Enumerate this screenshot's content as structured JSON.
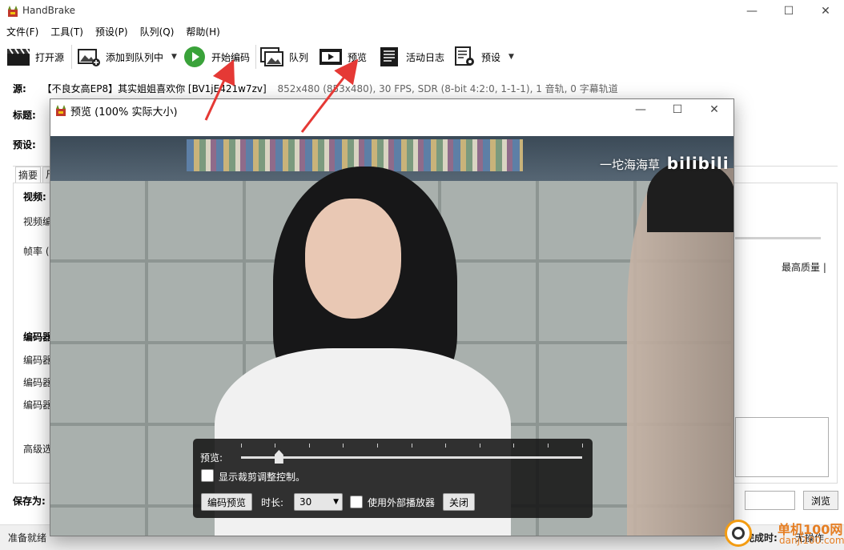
{
  "app": {
    "title": "HandBrake"
  },
  "window_controls": {
    "minimize": "—",
    "maximize": "☐",
    "close": "✕"
  },
  "menu": [
    "文件(F)",
    "工具(T)",
    "预设(P)",
    "队列(Q)",
    "帮助(H)"
  ],
  "toolbar": {
    "open_source": "打开源",
    "add_to_queue": "添加到队列中",
    "start_encode": "开始编码",
    "queue": "队列",
    "preview": "预览",
    "activity_log": "活动日志",
    "presets": "预设"
  },
  "source": {
    "label": "源:",
    "name": "【不良女高EP8】其实姐姐喜欢你 [BV1jE421w7zv]",
    "meta": "852x480 (853x480), 30 FPS, SDR (8-bit 4:2:0, 1-1-1), 1 音轨, 0 字幕轨道"
  },
  "main": {
    "title_label": "标题:",
    "preset_label": "预设:",
    "tab_summary": "摘要",
    "tab_partial": "尺",
    "video_heading": "视频:",
    "video_encoder_partial": "视频编",
    "framerate_partial": "帧率 (F",
    "encoder_heading_partial": "编码器",
    "encoder_row_partial": "编码器",
    "advanced_partial": "高级选",
    "best_quality": "最高质量 |",
    "save_as_label": "保存为:",
    "browse": "浏览"
  },
  "status": {
    "ready": "准备就绪",
    "when_done_label": "完成时:",
    "when_done_value": "无操作"
  },
  "preview_window": {
    "title": "预览 (100% 实际大小)",
    "watermark_text": "一坨海海草",
    "watermark_logo": "bilibili",
    "slider_label": "预览:",
    "slider_fraction": 0.11,
    "crop_checkbox_label": "显示裁剪调整控制。",
    "encode_preview_button": "编码预览",
    "duration_label": "时长:",
    "duration_value": "30",
    "external_player_label": "使用外部播放器",
    "close_button": "关闭"
  },
  "overlay": {
    "site_name": "单机100网",
    "site_url": "danji100.com"
  }
}
